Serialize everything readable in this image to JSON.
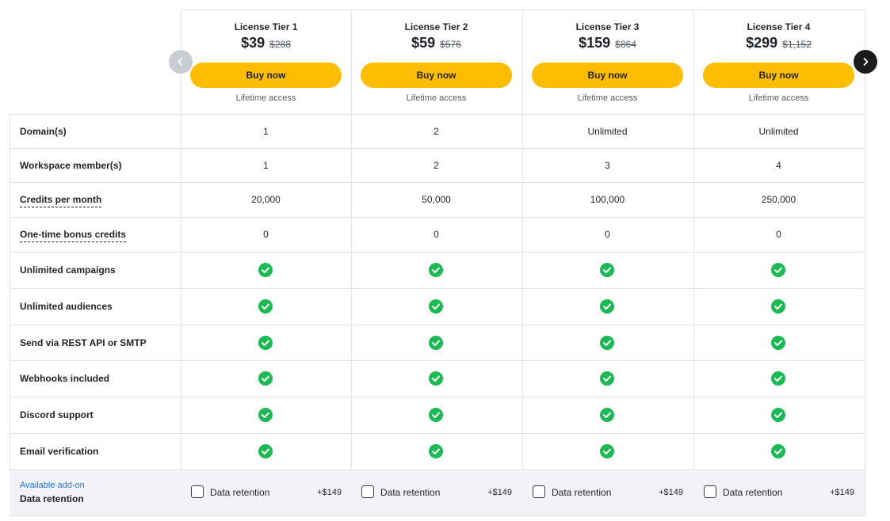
{
  "tiers": [
    {
      "name": "License Tier 1",
      "price": "$39",
      "old_price": "$288",
      "button": "Buy now",
      "access": "Lifetime access"
    },
    {
      "name": "License Tier 2",
      "price": "$59",
      "old_price": "$576",
      "button": "Buy now",
      "access": "Lifetime access"
    },
    {
      "name": "License Tier 3",
      "price": "$159",
      "old_price": "$864",
      "button": "Buy now",
      "access": "Lifetime access"
    },
    {
      "name": "License Tier 4",
      "price": "$299",
      "old_price": "$1,152",
      "button": "Buy now",
      "access": "Lifetime access"
    }
  ],
  "rows": [
    {
      "label": "Domain(s)",
      "dashed": false,
      "values": [
        "1",
        "2",
        "Unlimited",
        "Unlimited"
      ]
    },
    {
      "label": "Workspace member(s)",
      "dashed": false,
      "values": [
        "1",
        "2",
        "3",
        "4"
      ]
    },
    {
      "label": "Credits per month",
      "dashed": true,
      "values": [
        "20,000",
        "50,000",
        "100,000",
        "250,000"
      ]
    },
    {
      "label": "One-time bonus credits",
      "dashed": true,
      "values": [
        "0",
        "0",
        "0",
        "0"
      ]
    },
    {
      "label": "Unlimited campaigns",
      "dashed": false,
      "check": true
    },
    {
      "label": "Unlimited audiences",
      "dashed": false,
      "check": true
    },
    {
      "label": "Send via REST API or SMTP",
      "dashed": false,
      "check": true
    },
    {
      "label": "Webhooks included",
      "dashed": false,
      "check": true
    },
    {
      "label": "Discord support",
      "dashed": false,
      "check": true
    },
    {
      "label": "Email verification",
      "dashed": false,
      "check": true
    }
  ],
  "addon": {
    "link": "Available add-on",
    "title": "Data retention",
    "option_label": "Data retention",
    "option_price": "+$149"
  },
  "icons": {
    "check": "check-circle-icon",
    "prev": "chevron-left-icon",
    "next": "chevron-right-icon"
  },
  "colors": {
    "buy_button": "#ffbd00",
    "check": "#1db954",
    "addon_link": "#1a73e8",
    "nav_next": "#1b1b1b",
    "nav_prev": "#c9ccd1"
  }
}
